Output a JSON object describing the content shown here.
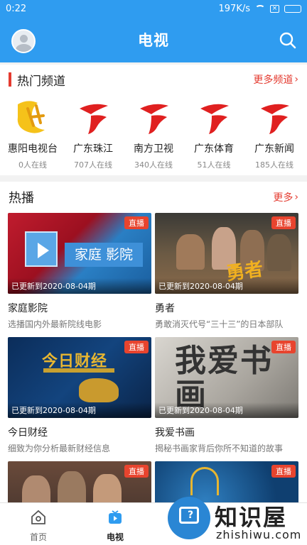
{
  "status_bar": {
    "time": "0:22",
    "net_speed": "197K/s"
  },
  "header": {
    "title": "电视"
  },
  "hot_channels": {
    "title": "热门频道",
    "more_label": "更多频道",
    "channels": [
      {
        "name": "惠阳电视台",
        "online": "0人在线"
      },
      {
        "name": "广东珠江",
        "online": "707人在线"
      },
      {
        "name": "南方卫视",
        "online": "340人在线"
      },
      {
        "name": "广东体育",
        "online": "51人在线"
      },
      {
        "name": "广东新闻",
        "online": "185人在线"
      }
    ]
  },
  "hot_play": {
    "title": "热播",
    "more_label": "更多",
    "badge": "直播",
    "items": [
      {
        "title": "家庭影院",
        "desc": "选播国内外最新院线电影",
        "updated": "已更新到2020-08-04期",
        "thumb_text": "家庭 影院"
      },
      {
        "title": "勇者",
        "desc": "勇敢消灭代号“三十三”的日本部队",
        "updated": "已更新到2020-08-04期",
        "thumb_text": "勇者"
      },
      {
        "title": "今日财经",
        "desc": "细致为你分析最新财经信息",
        "updated": "已更新到2020-08-04期",
        "thumb_text": "今日财经"
      },
      {
        "title": "我爱书画",
        "desc": "揭秘书画家背后你所不知道的故事",
        "updated": "已更新到2020-08-04期",
        "thumb_text": "我爱书画"
      },
      {
        "title": "",
        "desc": "",
        "updated": "",
        "thumb_text": ""
      },
      {
        "title": "",
        "desc": "",
        "updated": "",
        "thumb_text": ""
      }
    ]
  },
  "tabs": [
    {
      "label": "首页",
      "icon": "home-icon"
    },
    {
      "label": "电视",
      "icon": "tv-icon"
    },
    {
      "label": "",
      "icon": ""
    },
    {
      "label": "",
      "icon": ""
    }
  ],
  "watermark": {
    "text": "知识屋",
    "domain": "zhishiwu.com"
  },
  "colors": {
    "primary": "#2f9cf0",
    "accent": "#e43b30",
    "badge": "#e8442e"
  }
}
